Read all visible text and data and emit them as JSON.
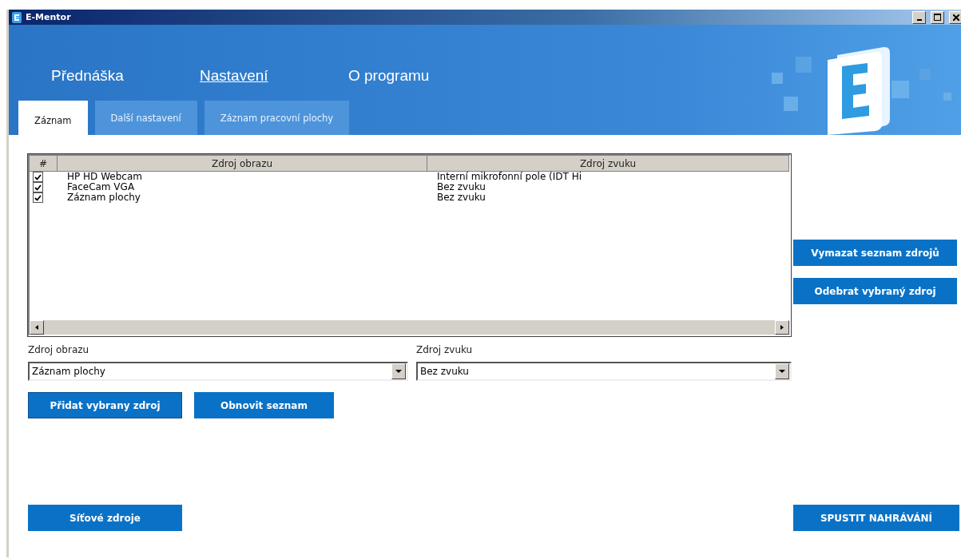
{
  "window": {
    "title": "E-Mentor"
  },
  "nav": [
    {
      "label": "Přednáška",
      "selected": false
    },
    {
      "label": "Nastavení",
      "selected": true
    },
    {
      "label": "O programu",
      "selected": false
    }
  ],
  "tabs": [
    {
      "label": "Záznam",
      "selected": true
    },
    {
      "label": "Další nastavení",
      "selected": false
    },
    {
      "label": "Záznam pracovní plochy",
      "selected": false
    }
  ],
  "table": {
    "columns": [
      "#",
      "Zdroj obrazu",
      "Zdroj zvuku"
    ],
    "rows": [
      {
        "checked": true,
        "image": "HP HD Webcam",
        "sound": "Interní mikrofonní pole (IDT Hi"
      },
      {
        "checked": true,
        "image": "FaceCam VGA",
        "sound": "Bez zvuku"
      },
      {
        "checked": true,
        "image": "Záznam plochy",
        "sound": "Bez zvuku"
      }
    ]
  },
  "side_buttons": [
    "Vymazat seznam zdrojů",
    "Odebrat vybraný zdroj"
  ],
  "fields": [
    {
      "label": "Zdroj obrazu",
      "value": "Záznam plochy"
    },
    {
      "label": "Zdroj zvuku",
      "value": "Bez zvuku"
    }
  ],
  "action_buttons": [
    {
      "label": "Přidat vybrany zdroj",
      "focused": true
    },
    {
      "label": "Obnovit seznam",
      "focused": false
    }
  ],
  "bottom_buttons": [
    "Síťové zdroje",
    "SPUSTIT NAHRÁVÁNÍ"
  ]
}
